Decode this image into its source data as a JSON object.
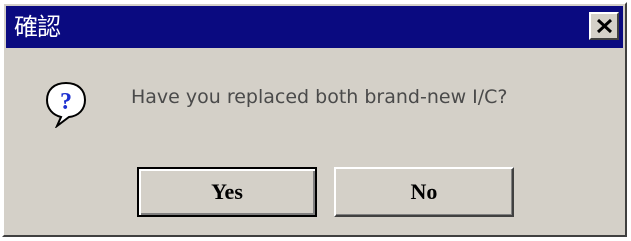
{
  "dialog": {
    "title": "確認",
    "message": "Have you replaced both brand-new I/C?",
    "icon": "question-icon",
    "close_icon": "close-icon",
    "buttons": {
      "yes_label": "Yes",
      "no_label": "No"
    }
  },
  "colors": {
    "titlebar": "#0a0a80",
    "dialog_face": "#d4d0c8",
    "title_text": "#ffffff",
    "message_text": "#4a4a4a",
    "icon_blue": "#1c2fd0"
  }
}
